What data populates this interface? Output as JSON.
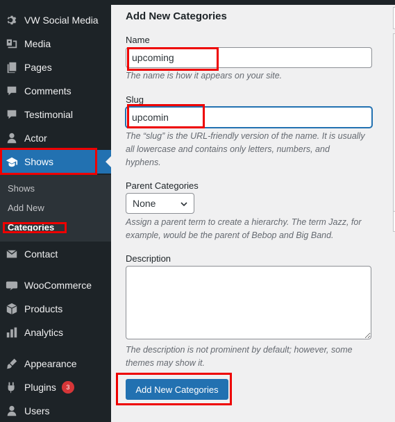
{
  "sidebar": {
    "items": [
      {
        "label": "VW Social Media",
        "icon": "gear-icon"
      },
      {
        "label": "Media",
        "icon": "media-icon"
      },
      {
        "label": "Pages",
        "icon": "pages-icon"
      },
      {
        "label": "Comments",
        "icon": "comment-icon"
      },
      {
        "label": "Testimonial",
        "icon": "comment-icon"
      },
      {
        "label": "Actor",
        "icon": "user-icon"
      },
      {
        "label": "Shows",
        "icon": "graduation-cap-icon",
        "active": true
      },
      {
        "label": "Contact",
        "icon": "envelope-icon"
      },
      {
        "label": "WooCommerce",
        "icon": "woo-icon"
      },
      {
        "label": "Products",
        "icon": "box-icon"
      },
      {
        "label": "Analytics",
        "icon": "chart-icon"
      },
      {
        "label": "Appearance",
        "icon": "brush-icon"
      },
      {
        "label": "Plugins",
        "icon": "plugin-icon",
        "badge": "3"
      },
      {
        "label": "Users",
        "icon": "user-icon"
      }
    ],
    "submenu": [
      "Shows",
      "Add New",
      "Categories"
    ],
    "active_color": "#2271b1"
  },
  "form": {
    "title": "Add New Categories",
    "name_label": "Name",
    "name_value": "upcoming",
    "name_help": "The name is how it appears on your site.",
    "slug_label": "Slug",
    "slug_value": "upcomin",
    "slug_help": "The “slug” is the URL-friendly version of the name. It is usually all lowercase and contains only letters, numbers, and hyphens.",
    "parent_label": "Parent Categories",
    "parent_selected": "None",
    "parent_help": "Assign a parent term to create a hierarchy. The term Jazz, for example, would be the parent of Bebop and Big Band.",
    "description_label": "Description",
    "description_value": "",
    "description_help": "The description is not prominent by default; however, some themes may show it.",
    "submit_label": "Add New Categories"
  },
  "highlight_color": "#e00000"
}
